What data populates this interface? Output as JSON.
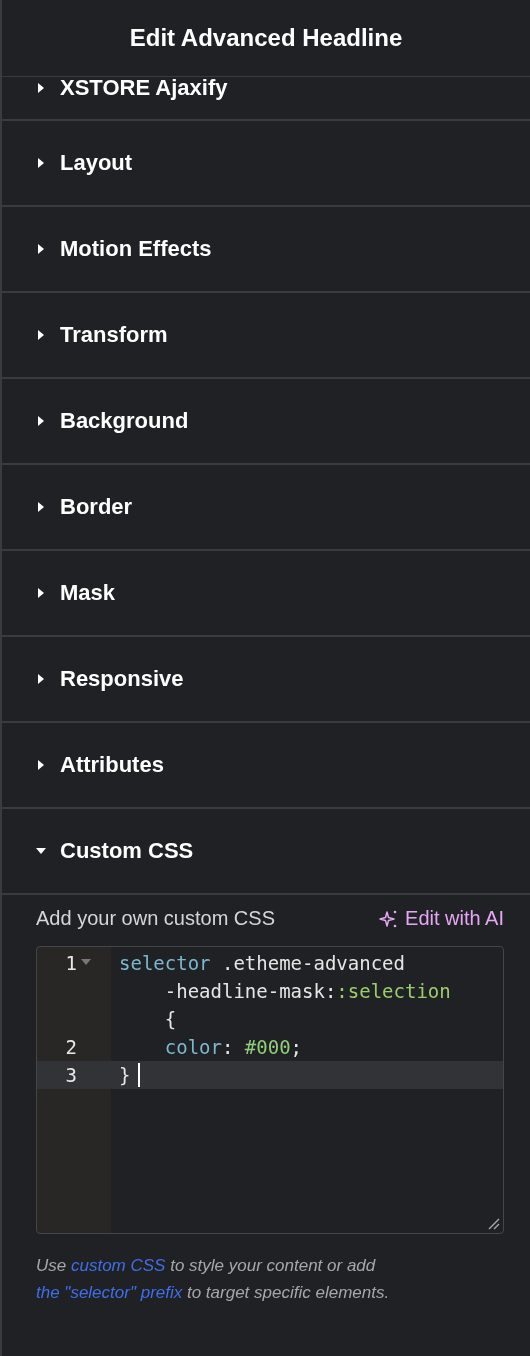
{
  "header": {
    "title": "Edit Advanced Headline"
  },
  "sections": [
    {
      "label": "XSTORE Ajaxify",
      "expanded": false,
      "partial": true
    },
    {
      "label": "Layout",
      "expanded": false
    },
    {
      "label": "Motion Effects",
      "expanded": false
    },
    {
      "label": "Transform",
      "expanded": false
    },
    {
      "label": "Background",
      "expanded": false
    },
    {
      "label": "Border",
      "expanded": false
    },
    {
      "label": "Mask",
      "expanded": false
    },
    {
      "label": "Responsive",
      "expanded": false
    },
    {
      "label": "Attributes",
      "expanded": false
    },
    {
      "label": "Custom CSS",
      "expanded": true
    }
  ],
  "custom_css": {
    "label": "Add your own custom CSS",
    "ai_button": "Edit with AI",
    "code_lines": [
      {
        "number": "1",
        "foldable": true,
        "active": false,
        "rows": [
          [
            {
              "kind": "keyword",
              "text": "selector"
            },
            {
              "kind": "plain",
              "text": " .etheme-advanced"
            }
          ],
          [
            {
              "kind": "plain",
              "text": "    -headline-mask:"
            },
            {
              "kind": "pseudo",
              "text": ":selection"
            }
          ],
          [
            {
              "kind": "plain",
              "text": "    {"
            }
          ]
        ]
      },
      {
        "number": "2",
        "foldable": false,
        "active": false,
        "rows": [
          [
            {
              "kind": "property",
              "text": "    color"
            },
            {
              "kind": "plain",
              "text": ": "
            },
            {
              "kind": "value",
              "text": "#000"
            },
            {
              "kind": "plain",
              "text": ";"
            }
          ]
        ]
      },
      {
        "number": "3",
        "foldable": false,
        "active": true,
        "rows": [
          [
            {
              "kind": "plain",
              "text": "}"
            }
          ]
        ]
      }
    ],
    "help": [
      {
        "kind": "text",
        "text": "Use "
      },
      {
        "kind": "link",
        "text": "custom CSS"
      },
      {
        "kind": "text",
        "text": " to style your content or add "
      },
      {
        "kind": "link",
        "text": "the \"selector\" prefix"
      },
      {
        "kind": "text",
        "text": " to target specific elements."
      }
    ]
  }
}
